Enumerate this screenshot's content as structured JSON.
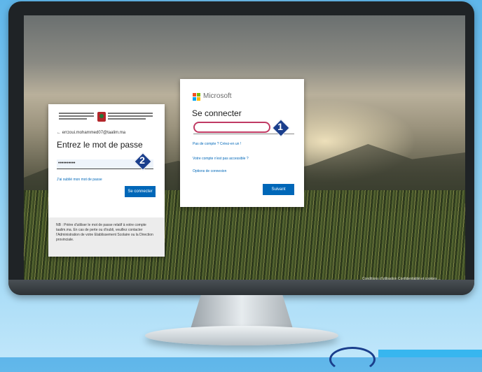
{
  "microsoft_signin": {
    "brand": "Microsoft",
    "title": "Se connecter",
    "links": [
      "Pas de compte ? Créez-en un !",
      "Votre compte n'est pas accessible ?",
      "Options de connexion"
    ],
    "next_label": "Suivant",
    "marker": "1"
  },
  "password_card": {
    "email": "← errzoui.mohammed07@taalim.ma",
    "title": "Entrez le mot de passe",
    "password_value": "••••••••••",
    "forgot": "J'ai oublié mon mot de passe",
    "submit_label": "Se connecter",
    "note": "NB : Prière d'utiliser le mot de passe relatif à votre compte taalim.ma. En cas de perte ou d'oubli, veuillez contacter l'Administration de votre Etablissement Scolaire ou la Direction provinciale.",
    "marker": "2"
  },
  "footer": {
    "links": "Conditions d'utilisation   Confidentialité et cookies   ..."
  },
  "colors": {
    "accent": "#0067b8",
    "highlight": "#c03a63",
    "marker": "#1a3e8c"
  }
}
